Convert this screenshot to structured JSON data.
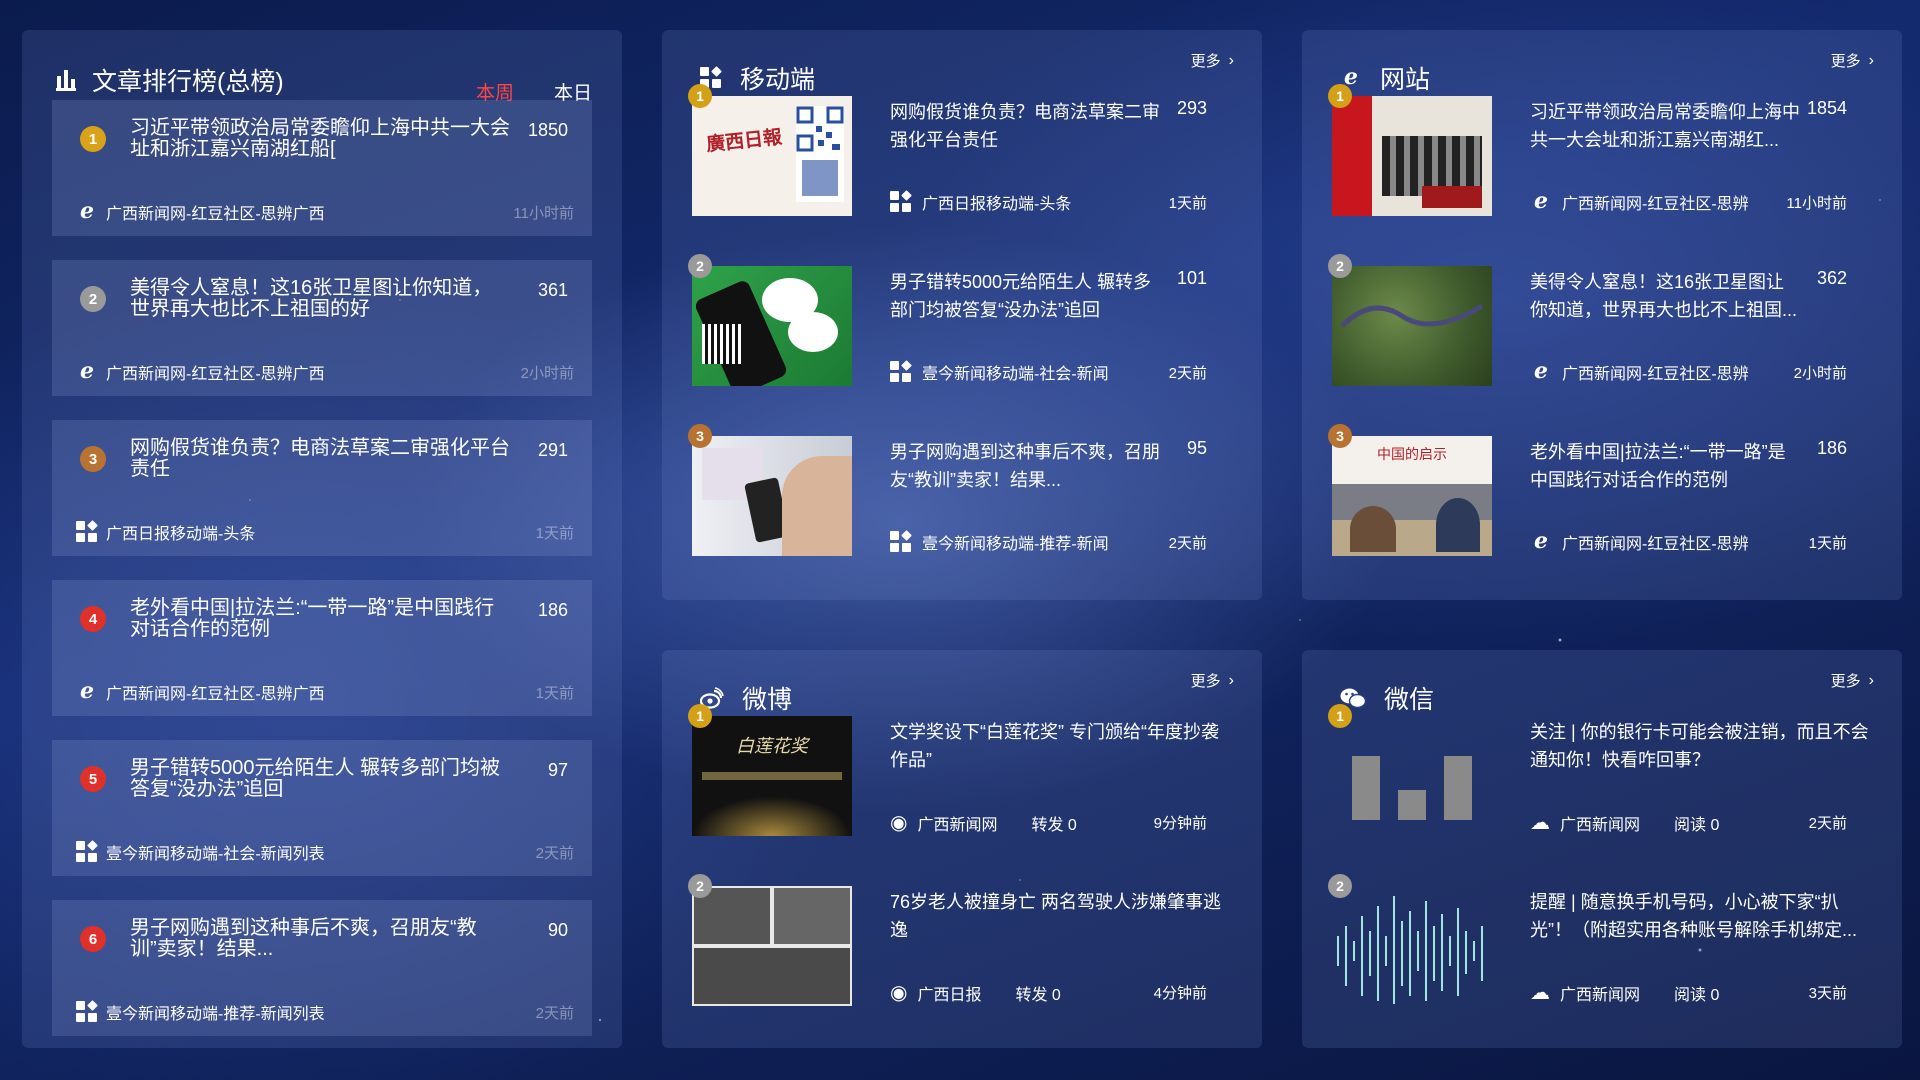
{
  "ranking": {
    "title": "文章排行榜(总榜)",
    "tabs": [
      "本周",
      "本日"
    ],
    "items": [
      {
        "rank": "1",
        "title": "习近平带领政治局常委瞻仰上海中共一大会址和浙江嘉兴南湖红船[",
        "count": "1850",
        "source": "广西新闻网-红豆社区-思辨广西",
        "time": "11小时前",
        "icon": "ie-icon"
      },
      {
        "rank": "2",
        "title": "美得令人窒息！这16张卫星图让你知道，世界再大也比不上祖国的好",
        "count": "361",
        "source": "广西新闻网-红豆社区-思辨广西",
        "time": "2小时前",
        "icon": "ie-icon"
      },
      {
        "rank": "3",
        "title": "网购假货谁负责？电商法草案二审强化平台责任",
        "count": "291",
        "source": "广西日报移动端-头条",
        "time": "1天前",
        "icon": "grid-icon"
      },
      {
        "rank": "4",
        "title": "老外看中国|拉法兰:“一带一路”是中国践行对话合作的范例",
        "count": "186",
        "source": "广西新闻网-红豆社区-思辨广西",
        "time": "1天前",
        "icon": "ie-icon"
      },
      {
        "rank": "5",
        "title": "男子错转5000元给陌生人 辗转多部门均被答复“没办法”追回",
        "count": "97",
        "source": "壹今新闻移动端-社会-新闻列表",
        "time": "2天前",
        "icon": "grid-icon"
      },
      {
        "rank": "6",
        "title": "男子网购遇到这种事后不爽，召朋友“教训”卖家！结果...",
        "count": "90",
        "source": "壹今新闻移动端-推荐-新闻列表",
        "time": "2天前",
        "icon": "grid-icon"
      }
    ],
    "colors": {
      "gold": "#d8a318",
      "silver": "#9a9a9a",
      "bronze": "#b87333",
      "red": "#e0302a"
    }
  },
  "mobile": {
    "title": "移动端",
    "more": "更多",
    "items": [
      {
        "rank": "1",
        "title": "网购假货谁负责？电商法草案二审强化平台责任",
        "count": "293",
        "source": "广西日报移动端-头条",
        "time": "1天前"
      },
      {
        "rank": "2",
        "title": "男子错转5000元给陌生人 辗转多部门均被答复“没办法”追回",
        "count": "101",
        "source": "壹今新闻移动端-社会-新闻",
        "time": "2天前"
      },
      {
        "rank": "3",
        "title": "男子网购遇到这种事后不爽，召朋友“教训”卖家！结果...",
        "count": "95",
        "source": "壹今新闻移动端-推荐-新闻",
        "time": "2天前"
      }
    ],
    "thumb1_text": "廣西日報"
  },
  "site": {
    "title": "网站",
    "more": "更多",
    "items": [
      {
        "rank": "1",
        "title": "习近平带领政治局常委瞻仰上海中共一大会址和浙江嘉兴南湖红...",
        "count": "1854",
        "source": "广西新闻网-红豆社区-思辨",
        "time": "11小时前"
      },
      {
        "rank": "2",
        "title": "美得令人窒息！这16张卫星图让你知道，世界再大也比不上祖国...",
        "count": "362",
        "source": "广西新闻网-红豆社区-思辨",
        "time": "2小时前"
      },
      {
        "rank": "3",
        "title": "老外看中国|拉法兰:“一带一路”是中国践行对话合作的范例",
        "count": "186",
        "source": "广西新闻网-红豆社区-思辨",
        "time": "1天前"
      }
    ],
    "thumb3_text": "中国的启示"
  },
  "weibo": {
    "title": "微博",
    "more": "更多",
    "items": [
      {
        "rank": "1",
        "title": "文学奖设下“白莲花奖” 专门颁给“年度抄袭作品”",
        "source": "广西新闻网",
        "extra": "转发 0",
        "time": "9分钟前"
      },
      {
        "rank": "2",
        "title": "76岁老人被撞身亡 两名驾驶人涉嫌肇事逃逸",
        "source": "广西日报",
        "extra": "转发 0",
        "time": "4分钟前"
      }
    ],
    "thumb1_text": "白莲花奖"
  },
  "wechat": {
    "title": "微信",
    "more": "更多",
    "items": [
      {
        "rank": "1",
        "title": "关注 | 你的银行卡可能会被注销，而且不会通知你！快看咋回事？",
        "source": "广西新闻网",
        "extra": "阅读 0",
        "time": "2天前"
      },
      {
        "rank": "2",
        "title": "提醒 | 随意换手机号码，小心被下家“扒光”！（附超实用各种账号解除手机绑定...",
        "source": "广西新闻网",
        "extra": "阅读 0",
        "time": "3天前"
      }
    ]
  }
}
